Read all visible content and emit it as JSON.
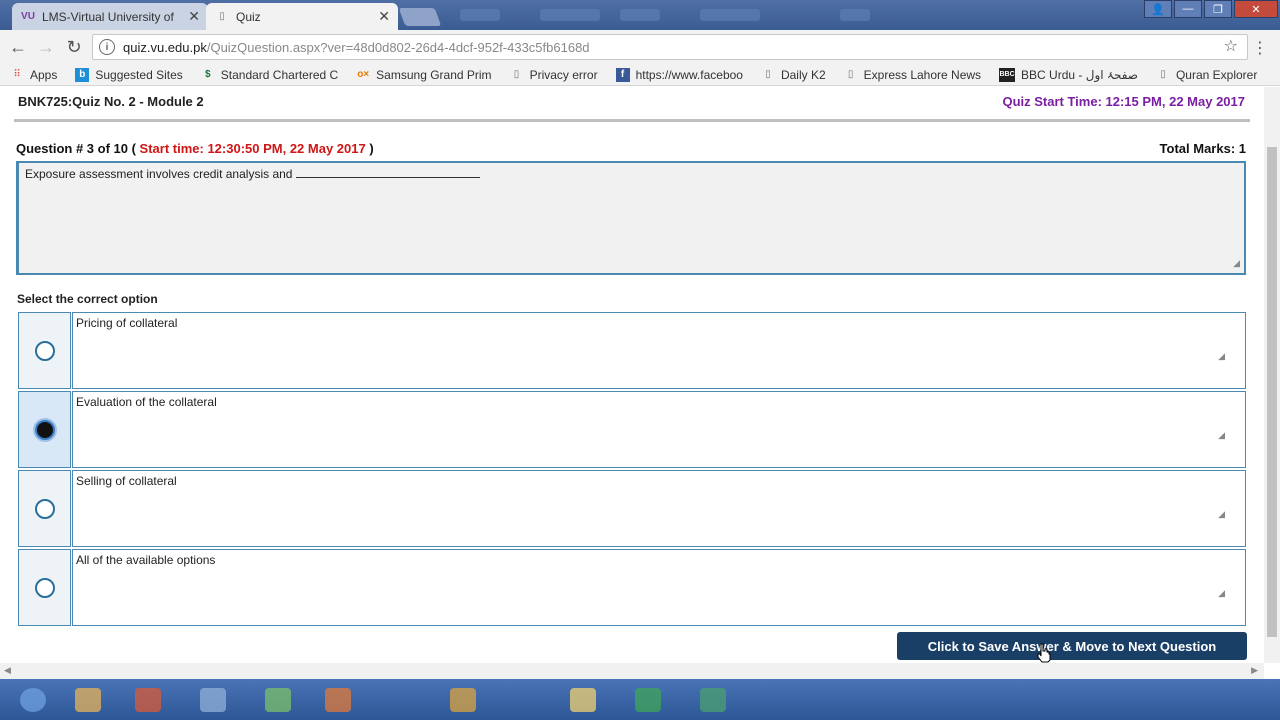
{
  "browser": {
    "tabs": [
      {
        "label": "LMS-Virtual University of",
        "icon": "lms-favicon",
        "active": false
      },
      {
        "label": "Quiz",
        "icon": "page-icon",
        "active": true
      }
    ],
    "url_domain": "quiz.vu.edu.pk",
    "url_path": "/QuizQuestion.aspx?ver=48d0d802-26d4-4dcf-952f-433c5fb6168d",
    "bookmarks": [
      {
        "label": "Apps",
        "icon": "apps-grid-icon"
      },
      {
        "label": "Suggested Sites",
        "icon": "suggested-sites-icon"
      },
      {
        "label": "Standard Chartered C",
        "icon": "standard-chartered-icon"
      },
      {
        "label": "Samsung Grand Prim",
        "icon": "olx-icon"
      },
      {
        "label": "Privacy error",
        "icon": "page-icon"
      },
      {
        "label": "https://www.faceboo",
        "icon": "facebook-icon"
      },
      {
        "label": "Daily K2",
        "icon": "page-icon"
      },
      {
        "label": "Express Lahore News",
        "icon": "page-icon"
      },
      {
        "label": "BBC Urdu - صفحۂ اول",
        "icon": "bbc-icon"
      },
      {
        "label": "Quran Explorer",
        "icon": "page-icon"
      }
    ]
  },
  "quiz": {
    "title": "BNK725:Quiz No. 2 - Module 2",
    "quiz_start_time": "Quiz Start Time: 12:15 PM, 22 May 2017",
    "question_number": "Question # 3 of 10 (",
    "question_start": "Start time: 12:30:50 PM, 22 May 2017",
    "question_close": ")",
    "total_marks": "Total Marks: 1",
    "question_text": "Exposure assessment involves credit analysis and",
    "select_label": "Select the correct option",
    "options": [
      {
        "text": "Pricing of collateral",
        "selected": false
      },
      {
        "text": "Evaluation of the collateral",
        "selected": true
      },
      {
        "text": "Selling of collateral",
        "selected": false
      },
      {
        "text": "All of the available options",
        "selected": false
      }
    ],
    "submit_label": "Click to Save Answer & Move to Next Question"
  },
  "colors": {
    "accent_border": "#4a8ab2",
    "start_time_red": "#d01515",
    "quiz_time_purple": "#7b1fa2",
    "button_bg": "#1a3f66"
  }
}
